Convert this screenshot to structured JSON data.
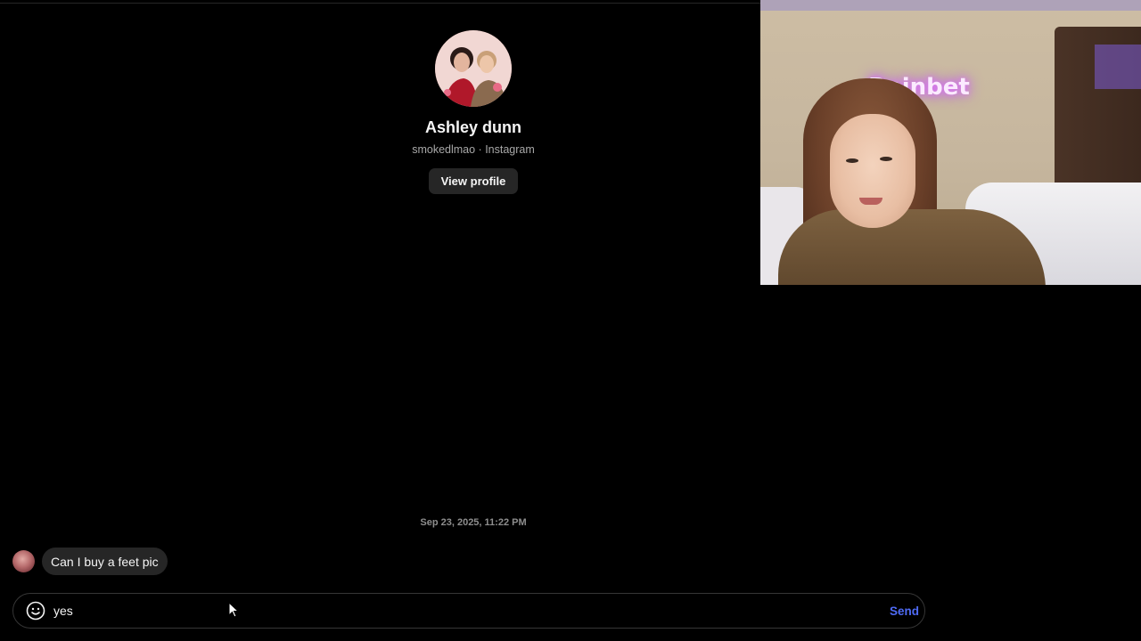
{
  "profile": {
    "name": "Ashley dunn",
    "subtitle": "smokedlmao · Instagram",
    "view_profile_label": "View profile",
    "avatar_icon": "profile-photo"
  },
  "thread": {
    "timestamp": "Sep 23, 2025, 11:22 PM",
    "messages": [
      {
        "sender": "Ashley dunn",
        "text": "Can I buy a feet pic"
      }
    ]
  },
  "composer": {
    "value": "yes",
    "emoji_icon": "smiley-face-icon",
    "send_label": "Send"
  },
  "webcam": {
    "neon_sign": "Rainbet"
  },
  "colors": {
    "background": "#000000",
    "bubble": "#262626",
    "accent_send": "#4f6bf6",
    "muted_text": "#a8a8a8"
  }
}
